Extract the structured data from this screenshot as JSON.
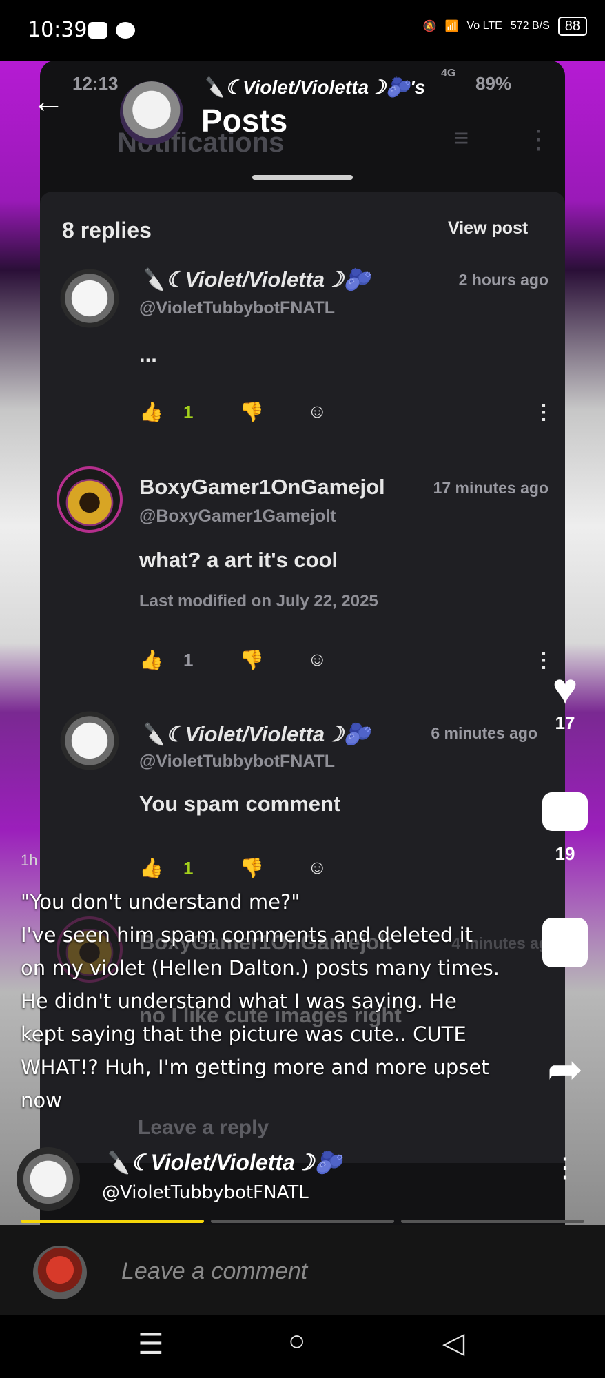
{
  "status_bar": {
    "time": "10:39",
    "network": "Vo LTE",
    "speed": "572 B/S",
    "battery": "88"
  },
  "inner_app": {
    "status_time": "12:13",
    "status_signal": "4G",
    "status_battery": "89%",
    "ghost_title": "Notifications",
    "name": "🔪☾Violet/Violetta☽🫐's",
    "title": "Posts",
    "replies": "8 replies",
    "view_post": "View post",
    "leave_reply": "Leave a reply"
  },
  "comments": [
    {
      "name": "🔪☾Violet/Violetta☽🫐",
      "handle": "@VioletTubbybotFNATL",
      "time": "2 hours ago",
      "body": "...",
      "likes": "1",
      "liked": true,
      "modified": ""
    },
    {
      "name": "BoxyGamer1OnGamejol",
      "handle": "@BoxyGamer1Gamejolt",
      "time": "17 minutes ago",
      "body": "what? a art it's cool",
      "modified": "Last modified on July 22, 2025",
      "likes": "1",
      "liked": false
    },
    {
      "name": "🔪☾Violet/Violetta☽🫐",
      "handle": "@VioletTubbybotFNATL",
      "time": "6 minutes ago",
      "body": "You spam comment",
      "likes": "1",
      "liked": true,
      "modified": ""
    },
    {
      "name": "BoxyGamer1OnGamejolt",
      "handle": "",
      "time": "4 minutes ag",
      "body": "no I like cute images right",
      "likes": "",
      "liked": false,
      "modified": ""
    }
  ],
  "rail": {
    "likes": "17",
    "comments": "19"
  },
  "caption": {
    "timestamp": "1h",
    "text": "\"You don't understand me?\"\nI've seen him spam comments and deleted it on my violet (Hellen Dalton.) posts many times. He didn't understand what I was saying. He kept saying that the picture was cute.. CUTE WHAT!? Huh, I'm getting more and more upset now"
  },
  "poster": {
    "name": "🔪☾Violet/Violetta☽🫐",
    "handle": "@VioletTubbybotFNATL"
  },
  "progress": {
    "segments": 3,
    "active_segment": 1,
    "active_color": "#f5d60a",
    "inactive_color": "#555555"
  },
  "comment_bar": {
    "placeholder": "Leave a comment"
  },
  "icons": {
    "back": "arrow-left-icon",
    "like": "thumbs-up-icon",
    "dislike": "thumbs-down-icon",
    "emoji": "add-emoji-icon",
    "more": "vertical-dots-icon",
    "heart": "heart-icon",
    "comment": "comment-bubble-icon",
    "save": "bookmark-icon",
    "share": "share-arrow-icon"
  },
  "colors": {
    "like_active": "#a4d11c",
    "moon_badge": "#6a31c7"
  }
}
